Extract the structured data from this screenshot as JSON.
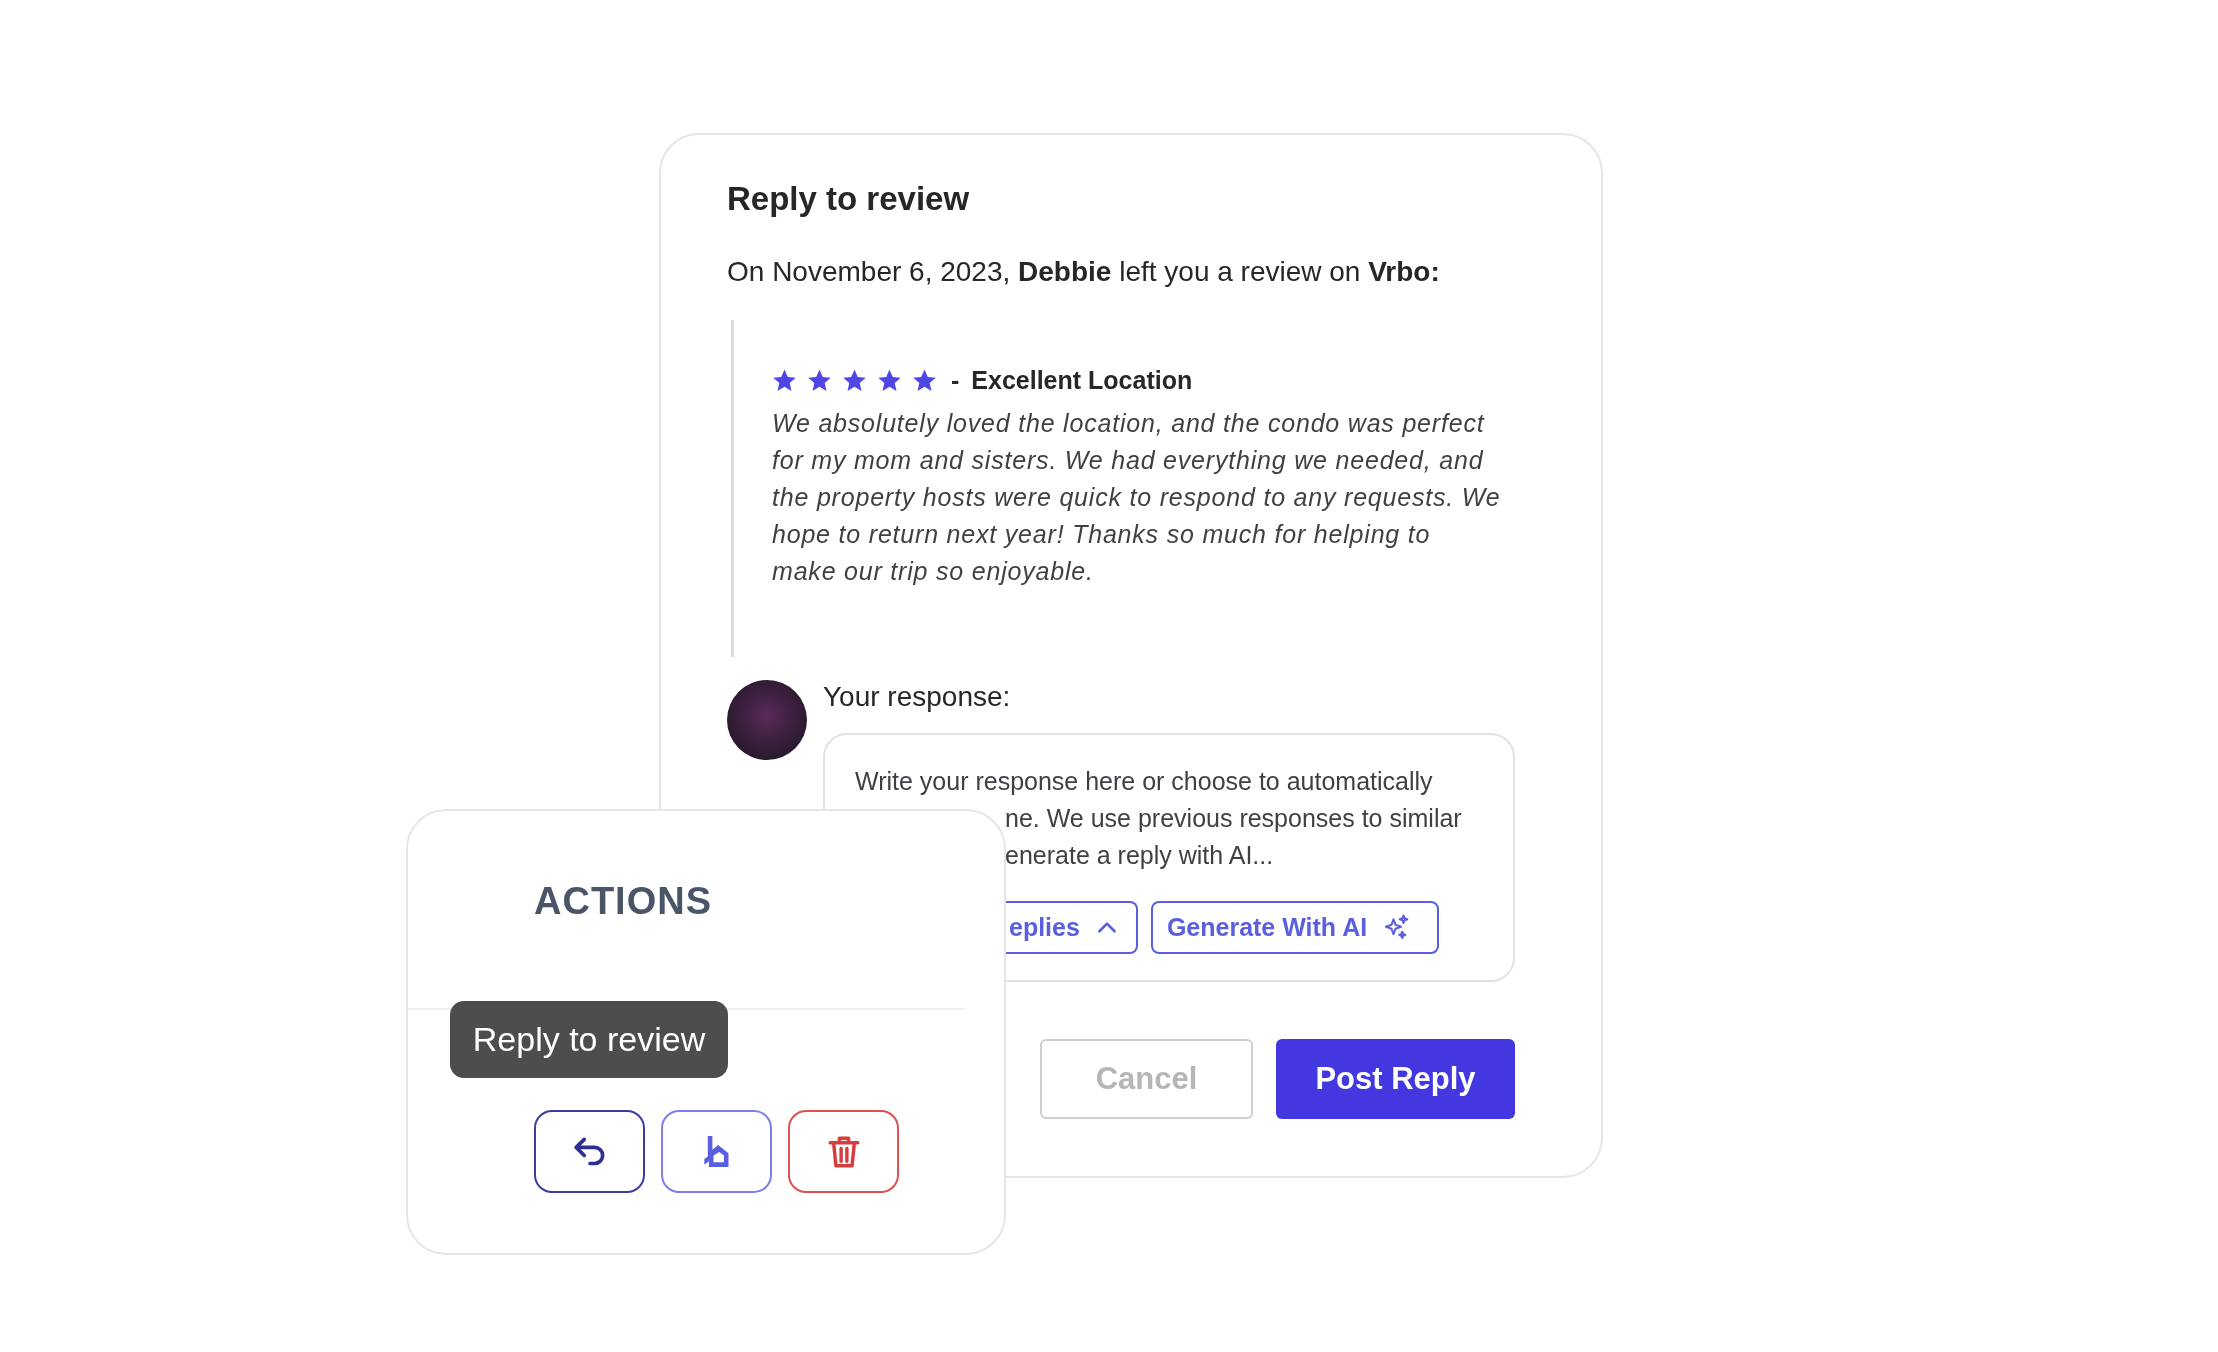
{
  "dialog": {
    "title": "Reply to review",
    "intro": "On November 6, 2023, **Debbie** left you a review on **Vrbo:**",
    "review": {
      "stars": 5,
      "separator": "-",
      "title": "Excellent Location",
      "text": "We absolutely loved the location, and the condo was perfect for my mom and sisters. We had everything we needed, and the property hosts were quick to respond to any requests. We hope to return next year! Thanks so much for helping to make our trip so enjoyable."
    },
    "response": {
      "label": "Your response:",
      "placeholder_lines": [
        "Write your response here or choose to automatically",
        "ne. We use previous responses to similar",
        "enerate a reply with AI..."
      ],
      "buttons": [
        {
          "label": "eplies",
          "kind": "dropdown"
        },
        {
          "label": "Generate With AI",
          "kind": "ai"
        }
      ]
    },
    "actions": [
      {
        "label": "Cancel",
        "kind": "secondary"
      },
      {
        "label": "Post Reply",
        "kind": "primary"
      }
    ]
  },
  "actions_panel": {
    "title": "ACTIONS",
    "tooltip": "Reply to review",
    "buttons": [
      {
        "kind": "reply"
      },
      {
        "kind": "vrbo"
      },
      {
        "kind": "delete"
      }
    ]
  }
}
